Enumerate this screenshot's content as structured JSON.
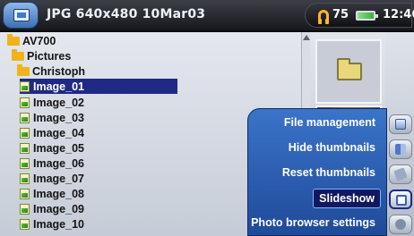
{
  "header": {
    "title": "JPG 640x480 10Mar03",
    "volume": "75",
    "clock": "12:46"
  },
  "files": [
    {
      "name": "AV700",
      "type": "folder"
    },
    {
      "name": "Pictures",
      "type": "folder"
    },
    {
      "name": "Christoph",
      "type": "folder"
    },
    {
      "name": "Image_01",
      "type": "image",
      "selected": true
    },
    {
      "name": "Image_02",
      "type": "image"
    },
    {
      "name": "Image_03",
      "type": "image"
    },
    {
      "name": "Image_04",
      "type": "image"
    },
    {
      "name": "Image_05",
      "type": "image"
    },
    {
      "name": "Image_06",
      "type": "image"
    },
    {
      "name": "Image_07",
      "type": "image"
    },
    {
      "name": "Image_08",
      "type": "image"
    },
    {
      "name": "Image_09",
      "type": "image"
    },
    {
      "name": "Image_10",
      "type": "image"
    }
  ],
  "menu": {
    "items": [
      {
        "label": "File management"
      },
      {
        "label": "Hide thumbnails"
      },
      {
        "label": "Reset thumbnails"
      },
      {
        "label": "Slideshow",
        "selected": true
      },
      {
        "label": "Photo browser settings"
      }
    ]
  },
  "sidebar": {
    "icons": [
      "manage-icon",
      "hide-thumbs-icon",
      "reset-thumbs-icon",
      "slideshow-icon",
      "settings-icon"
    ],
    "active": "slideshow-icon"
  },
  "colors": {
    "selection": "#1e2a84",
    "menu": "#3b74c8",
    "folder": "#f2b21b",
    "headphones": "#ffb62a"
  }
}
